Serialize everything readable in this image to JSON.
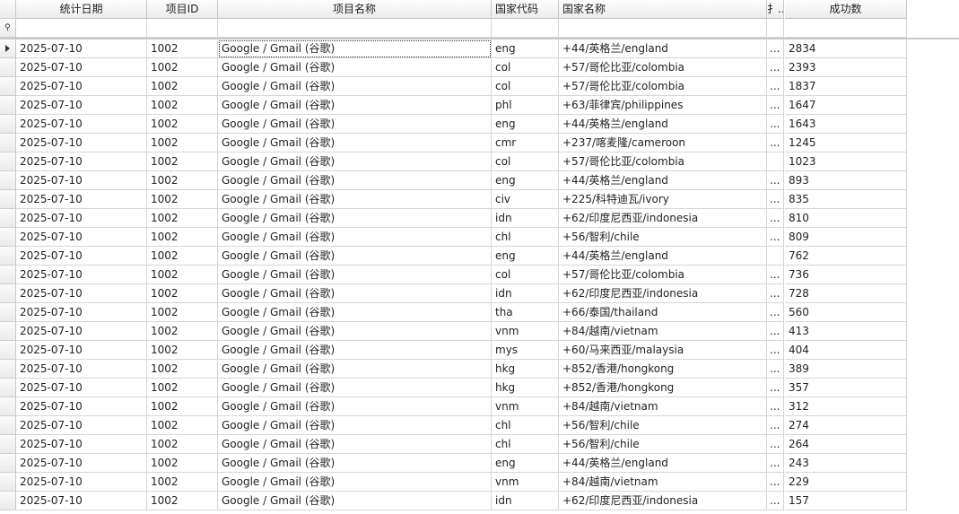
{
  "columns": {
    "date": "统计日期",
    "project_id": "项目ID",
    "project_name": "项目名称",
    "country_code": "国家代码",
    "country_name": "国家名称",
    "truncated": "扌..",
    "success_count": "成功数"
  },
  "filter_row_icon": "filter-pin-icon",
  "current_row_icon": "row-pointer-arrow-icon",
  "rows": [
    {
      "date": "2025-07-10",
      "pid": "1002",
      "name": "Google / Gmail (谷歌)",
      "code": "eng",
      "cname": "+44/英格兰/england",
      "x": "...",
      "count": "2834"
    },
    {
      "date": "2025-07-10",
      "pid": "1002",
      "name": "Google / Gmail (谷歌)",
      "code": "col",
      "cname": "+57/哥伦比亚/colombia",
      "x": "...",
      "count": "2393"
    },
    {
      "date": "2025-07-10",
      "pid": "1002",
      "name": "Google / Gmail (谷歌)",
      "code": "col",
      "cname": "+57/哥伦比亚/colombia",
      "x": "...",
      "count": "1837"
    },
    {
      "date": "2025-07-10",
      "pid": "1002",
      "name": "Google / Gmail (谷歌)",
      "code": "phl",
      "cname": "+63/菲律宾/philippines",
      "x": "...",
      "count": "1647"
    },
    {
      "date": "2025-07-10",
      "pid": "1002",
      "name": "Google / Gmail (谷歌)",
      "code": "eng",
      "cname": "+44/英格兰/england",
      "x": "...",
      "count": "1643"
    },
    {
      "date": "2025-07-10",
      "pid": "1002",
      "name": "Google / Gmail (谷歌)",
      "code": "cmr",
      "cname": "+237/喀麦隆/cameroon",
      "x": "...",
      "count": "1245"
    },
    {
      "date": "2025-07-10",
      "pid": "1002",
      "name": "Google / Gmail (谷歌)",
      "code": "col",
      "cname": "+57/哥伦比亚/colombia",
      "x": "",
      "count": "1023"
    },
    {
      "date": "2025-07-10",
      "pid": "1002",
      "name": "Google / Gmail (谷歌)",
      "code": "eng",
      "cname": "+44/英格兰/england",
      "x": "...",
      "count": "893"
    },
    {
      "date": "2025-07-10",
      "pid": "1002",
      "name": "Google / Gmail (谷歌)",
      "code": "civ",
      "cname": "+225/科特迪瓦/ivory",
      "x": "...",
      "count": "835"
    },
    {
      "date": "2025-07-10",
      "pid": "1002",
      "name": "Google / Gmail (谷歌)",
      "code": "idn",
      "cname": "+62/印度尼西亚/indonesia",
      "x": "...",
      "count": "810"
    },
    {
      "date": "2025-07-10",
      "pid": "1002",
      "name": "Google / Gmail (谷歌)",
      "code": "chl",
      "cname": "+56/智利/chile",
      "x": "...",
      "count": "809"
    },
    {
      "date": "2025-07-10",
      "pid": "1002",
      "name": "Google / Gmail (谷歌)",
      "code": "eng",
      "cname": "+44/英格兰/england",
      "x": "",
      "count": "762"
    },
    {
      "date": "2025-07-10",
      "pid": "1002",
      "name": "Google / Gmail (谷歌)",
      "code": "col",
      "cname": "+57/哥伦比亚/colombia",
      "x": "...",
      "count": "736"
    },
    {
      "date": "2025-07-10",
      "pid": "1002",
      "name": "Google / Gmail (谷歌)",
      "code": "idn",
      "cname": "+62/印度尼西亚/indonesia",
      "x": "...",
      "count": "728"
    },
    {
      "date": "2025-07-10",
      "pid": "1002",
      "name": "Google / Gmail (谷歌)",
      "code": "tha",
      "cname": "+66/泰国/thailand",
      "x": "...",
      "count": "560"
    },
    {
      "date": "2025-07-10",
      "pid": "1002",
      "name": "Google / Gmail (谷歌)",
      "code": "vnm",
      "cname": "+84/越南/vietnam",
      "x": "...",
      "count": "413"
    },
    {
      "date": "2025-07-10",
      "pid": "1002",
      "name": "Google / Gmail (谷歌)",
      "code": "mys",
      "cname": "+60/马来西亚/malaysia",
      "x": "...",
      "count": "404"
    },
    {
      "date": "2025-07-10",
      "pid": "1002",
      "name": "Google / Gmail (谷歌)",
      "code": "hkg",
      "cname": "+852/香港/hongkong",
      "x": "...",
      "count": "389"
    },
    {
      "date": "2025-07-10",
      "pid": "1002",
      "name": "Google / Gmail (谷歌)",
      "code": "hkg",
      "cname": "+852/香港/hongkong",
      "x": "...",
      "count": "357"
    },
    {
      "date": "2025-07-10",
      "pid": "1002",
      "name": "Google / Gmail (谷歌)",
      "code": "vnm",
      "cname": "+84/越南/vietnam",
      "x": "...",
      "count": "312"
    },
    {
      "date": "2025-07-10",
      "pid": "1002",
      "name": "Google / Gmail (谷歌)",
      "code": "chl",
      "cname": "+56/智利/chile",
      "x": "...",
      "count": "274"
    },
    {
      "date": "2025-07-10",
      "pid": "1002",
      "name": "Google / Gmail (谷歌)",
      "code": "chl",
      "cname": "+56/智利/chile",
      "x": "...",
      "count": "264"
    },
    {
      "date": "2025-07-10",
      "pid": "1002",
      "name": "Google / Gmail (谷歌)",
      "code": "eng",
      "cname": "+44/英格兰/england",
      "x": "...",
      "count": "243"
    },
    {
      "date": "2025-07-10",
      "pid": "1002",
      "name": "Google / Gmail (谷歌)",
      "code": "vnm",
      "cname": "+84/越南/vietnam",
      "x": "...",
      "count": "229"
    },
    {
      "date": "2025-07-10",
      "pid": "1002",
      "name": "Google / Gmail (谷歌)",
      "code": "idn",
      "cname": "+62/印度尼西亚/indonesia",
      "x": "...",
      "count": "157"
    }
  ]
}
